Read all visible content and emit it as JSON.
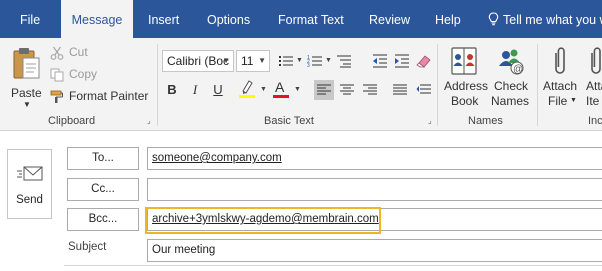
{
  "tabs": [
    {
      "label": "File"
    },
    {
      "label": "Message"
    },
    {
      "label": "Insert"
    },
    {
      "label": "Options"
    },
    {
      "label": "Format Text"
    },
    {
      "label": "Review"
    },
    {
      "label": "Help"
    },
    {
      "label": "Tell me what you w"
    }
  ],
  "active_tab": "Message",
  "clipboard": {
    "paste_label": "Paste",
    "cut_label": "Cut",
    "copy_label": "Copy",
    "format_painter_label": "Format Painter",
    "group_label": "Clipboard"
  },
  "basic_text": {
    "font_name": "Calibri (Boc",
    "font_size": "11",
    "group_label": "Basic Text"
  },
  "names": {
    "address_book_line1": "Address",
    "address_book_line2": "Book",
    "check_names_line1": "Check",
    "check_names_line2": "Names",
    "group_label": "Names"
  },
  "include": {
    "attach_file_line1": "Attach",
    "attach_file_line2": "File",
    "attach_item_line1": "Attac",
    "attach_item_line2": "Ite",
    "group_label": "Inc"
  },
  "compose": {
    "send_label": "Send",
    "to_label": "To...",
    "to_value": "someone@company.com",
    "cc_label": "Cc...",
    "cc_value": "",
    "bcc_label": "Bcc...",
    "bcc_value": "archive+3ymlskwy-agdemo@membrain.com",
    "subject_label": "Subject",
    "subject_value": "Our meeting"
  },
  "colors": {
    "titlebar": "#2b579a",
    "ribbon": "#f3f3f3",
    "highlight": "#f0b429",
    "highlight_yellow": "#ffff00",
    "font_red": "#e81123"
  }
}
